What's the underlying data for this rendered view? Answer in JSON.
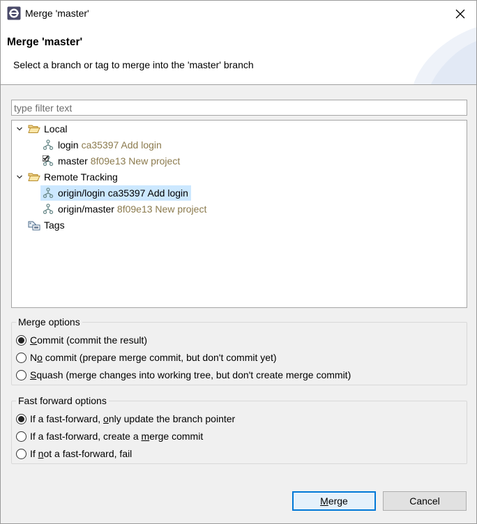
{
  "window": {
    "title": "Merge 'master'"
  },
  "banner": {
    "title": "Merge 'master'",
    "message": "Select a branch or tag to merge into the 'master' branch"
  },
  "filter": {
    "placeholder": "type filter text",
    "value": ""
  },
  "tree": {
    "local": {
      "label": "Local",
      "items": [
        {
          "name": "login",
          "commit": "ca35397 Add login"
        },
        {
          "name": "master",
          "commit": "8f09e13 New project",
          "checked_out": true
        }
      ]
    },
    "remote": {
      "label": "Remote Tracking",
      "items": [
        {
          "name": "origin/login",
          "commit": "ca35397 Add login",
          "selected": true
        },
        {
          "name": "origin/master",
          "commit": "8f09e13 New project"
        }
      ]
    },
    "tags": {
      "label": "Tags"
    }
  },
  "merge_options": {
    "legend": "Merge options",
    "selected": "commit",
    "options": [
      {
        "id": "commit",
        "mnemonic": "C",
        "rest": "ommit (commit the result)"
      },
      {
        "id": "no-commit",
        "pre": "N",
        "mnemonic": "o",
        "rest": " commit (prepare merge commit, but don't commit yet)"
      },
      {
        "id": "squash",
        "mnemonic": "S",
        "rest": "quash (merge changes into working tree, but don't create merge commit)"
      }
    ]
  },
  "ff_options": {
    "legend": "Fast forward options",
    "selected": "ff-only-update",
    "options": [
      {
        "id": "ff-only-update",
        "pre": "If a fast-forward, ",
        "mnemonic": "o",
        "rest": "nly update the branch pointer"
      },
      {
        "id": "ff-create-merge",
        "pre": "If a fast-forward, create a ",
        "mnemonic": "m",
        "rest": "erge commit"
      },
      {
        "id": "ff-fail",
        "pre": "If ",
        "mnemonic": "n",
        "rest": "ot a fast-forward, fail"
      }
    ]
  },
  "buttons": {
    "merge": {
      "mnemonic": "M",
      "rest": "erge"
    },
    "cancel": "Cancel"
  },
  "colors": {
    "selection": "#cce8ff",
    "commit_text": "#8b7a4d",
    "default_button_border": "#0078d7"
  }
}
